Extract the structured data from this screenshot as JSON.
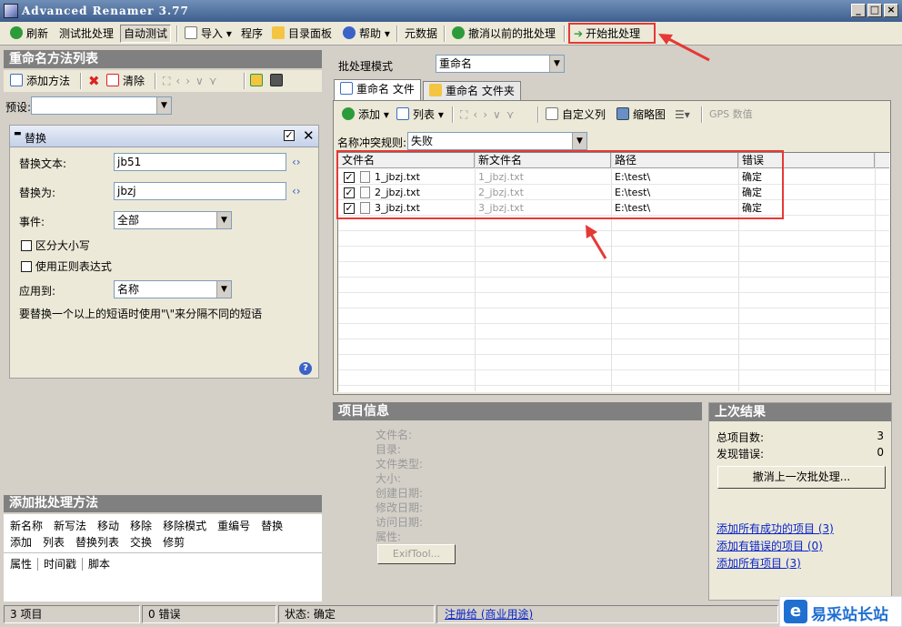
{
  "window": {
    "title": "Advanced Renamer 3.77"
  },
  "toolbar": {
    "refresh": "刷新",
    "test_batch": "测试批处理",
    "auto_test": "自动测试",
    "import": "导入",
    "program": "程序",
    "dir_panel": "目录面板",
    "help": "帮助",
    "metadata": "元数据",
    "undo_batch": "撤消以前的批处理",
    "start_batch": "开始批处理"
  },
  "left": {
    "panel_title": "重命名方法列表",
    "add_method": "添加方法",
    "clear": "清除",
    "preset_label": "预设:",
    "preset_value": "",
    "method": {
      "title": "替换",
      "replace_text_label": "替换文本:",
      "replace_text_value": "jb51",
      "replace_with_label": "替换为:",
      "replace_with_value": "jbzj",
      "occurrence_label": "事件:",
      "occurrence_value": "全部",
      "case_sensitive": "区分大小写",
      "use_regex": "使用正则表达式",
      "apply_to_label": "应用到:",
      "apply_to_value": "名称",
      "hint": "要替换一个以上的短语时使用\"\\\"来分隔不同的短语"
    },
    "add_methods_title": "添加批处理方法",
    "method_row1": [
      "新名称",
      "新写法",
      "移动",
      "移除",
      "移除模式",
      "重编号",
      "替换"
    ],
    "method_row2": [
      "添加",
      "列表",
      "替换列表",
      "交换",
      "修剪"
    ],
    "method_tabs": [
      "属性",
      "时间戳",
      "脚本"
    ]
  },
  "right": {
    "mode_label": "批处理模式",
    "mode_value": "重命名",
    "tabs": [
      "重命名 文件",
      "重命名 文件夹"
    ],
    "file_toolbar": {
      "add": "添加",
      "list": "列表",
      "custom_columns": "自定义列",
      "thumbnails": "缩略图",
      "gps": "GPS 数值"
    },
    "conflict_label": "名称冲突规则:",
    "conflict_value": "失败",
    "columns": [
      "文件名",
      "新文件名",
      "路径",
      "错误"
    ],
    "files": [
      {
        "name": "1_jbzj.txt",
        "new_name": "1_jbzj.txt",
        "path": "E:\\test\\",
        "error": "确定"
      },
      {
        "name": "2_jbzj.txt",
        "new_name": "2_jbzj.txt",
        "path": "E:\\test\\",
        "error": "确定"
      },
      {
        "name": "3_jbzj.txt",
        "new_name": "3_jbzj.txt",
        "path": "E:\\test\\",
        "error": "确定"
      }
    ]
  },
  "item_info": {
    "title": "项目信息",
    "fields": [
      "文件名:",
      "目录:",
      "文件类型:",
      "大小:",
      "创建日期:",
      "修改日期:",
      "访问日期:",
      "属性:"
    ],
    "exiftool": "ExifTool..."
  },
  "last_result": {
    "title": "上次结果",
    "total_label": "总项目数:",
    "total_value": "3",
    "errors_label": "发现错误:",
    "errors_value": "0",
    "undo_last": "撤消上一次批处理...",
    "link_success": "添加所有成功的项目 (3)",
    "link_errors": "添加有错误的项目 (0)",
    "link_all": "添加所有项目 (3)"
  },
  "statusbar": {
    "items": "3 项目",
    "errors": "0 错误",
    "status": "状态:  确定",
    "register": "注册给 (商业用途)"
  },
  "watermark": {
    "text": "易采站长站"
  }
}
